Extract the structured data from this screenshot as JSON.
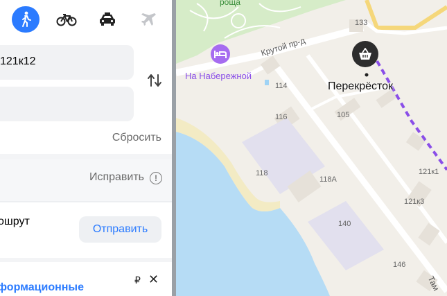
{
  "transport_modes": [
    {
      "name": "walking",
      "icon": "walking-person-icon",
      "active": true
    },
    {
      "name": "bike",
      "icon": "bicycle-icon",
      "active": false
    },
    {
      "name": "taxi",
      "icon": "taxi-icon",
      "active": false
    },
    {
      "name": "plane",
      "icon": "airplane-icon",
      "active": false
    }
  ],
  "route_form": {
    "from_value": "121к12",
    "to_value": "",
    "swap_icon": "swap-arrows-icon",
    "reset_label": "Сбросить"
  },
  "fix_row": {
    "label": "Исправить",
    "icon": "info-icon"
  },
  "send_row": {
    "text": "ошрут",
    "button_label": "Отправить"
  },
  "bottom_banner": {
    "link_text": "формационные",
    "currency_symbol": "₽",
    "close_icon": "close-icon"
  },
  "map": {
    "grove_label": "роща",
    "street_label": "Крутой пр-д",
    "hotel_label": "На Набережной",
    "shop_label": "Перекрёсток",
    "house_numbers": [
      "133",
      "114",
      "116",
      "105",
      "118",
      "118А",
      "121к1",
      "121к3",
      "140",
      "146"
    ],
    "street_label_2": "Там",
    "colors": {
      "hotel": "#a66cf0",
      "route": "#8a4ee8",
      "water": "#b6dcf5",
      "park": "#d6ecc8",
      "accent": "#2b7bff"
    }
  }
}
